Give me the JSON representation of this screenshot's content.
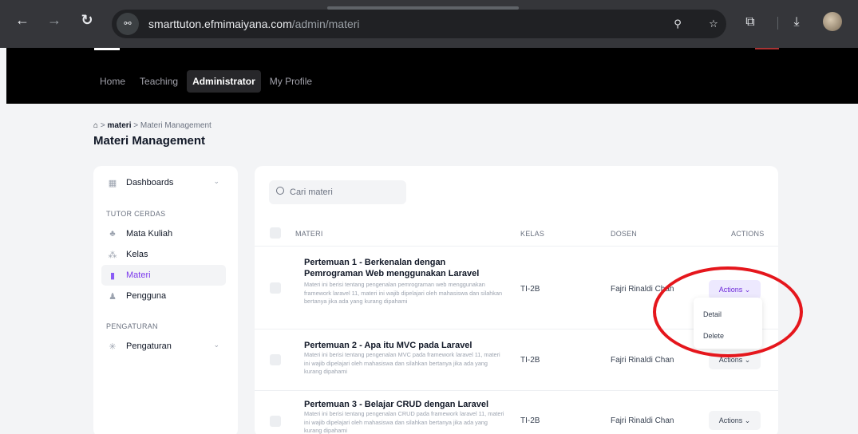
{
  "browser": {
    "url_domain": "smarttuton.efmimaiyana.com",
    "url_path": "/admin/materi",
    "icons": [
      "back-icon",
      "forward-icon",
      "reload-icon",
      "site-info-icon",
      "zoom-icon",
      "bookmark-star-icon",
      "extensions-icon",
      "download-icon",
      "profile-avatar"
    ]
  },
  "header": {
    "nav": [
      "Home",
      "Teaching",
      "Administrator",
      "My Profile"
    ],
    "active_nav": "Administrator"
  },
  "page": {
    "breadcrumb_current": "materi",
    "breadcrumb_sep": ">",
    "breadcrumb_leaf": "Materi Management",
    "title": "Materi Management"
  },
  "sidebar": {
    "dashboards": "Dashboards",
    "section_tutor": "TUTOR CERDAS",
    "items": [
      "Mata Kuliah",
      "Kelas",
      "Materi",
      "Pengguna"
    ],
    "active": "Materi",
    "section_settings": "PENGATURAN",
    "settings": "Pengaturan"
  },
  "table": {
    "search_placeholder": "Cari materi",
    "columns": {
      "materi": "MATERI",
      "kelas": "KELAS",
      "dosen": "DOSEN",
      "actions": "ACTIONS"
    },
    "rows": [
      {
        "title": "Pertemuan 1 - Berkenalan dengan Pemrograman Web menggunakan Laravel",
        "desc": "Materi ini berisi tentang pengenalan pemrograman web menggunakan framework laravel 11, materi ini wajib dipelajari oleh mahasiswa dan silahkan bertanya jika ada yang kurang dipahami",
        "kelas": "TI-2B",
        "dosen": "Fajri Rinaldi Chan",
        "actions": "Actions ⌄"
      },
      {
        "title": "Pertemuan 2 - Apa itu MVC pada Laravel",
        "desc": "Materi ini berisi tentang pengenalan MVC pada framework laravel 11, materi ini wajib dipelajari oleh mahasiswa dan silahkan bertanya jika ada yang kurang dipahami",
        "kelas": "TI-2B",
        "dosen": "Fajri Rinaldi Chan",
        "actions": "Actions ⌄"
      },
      {
        "title": "Pertemuan 3 - Belajar CRUD dengan Laravel",
        "desc": "Materi ini berisi tentang pengenalan CRUD pada framework laravel 11, materi ini wajib dipelajari oleh mahasiswa dan silahkan bertanya jika ada yang kurang dipahami",
        "kelas": "TI-2B",
        "dosen": "Fajri Rinaldi Chan",
        "actions": "Actions ⌄"
      }
    ],
    "dropdown": [
      "Detail",
      "Delete"
    ]
  },
  "colors": {
    "accent": "#7c3aed",
    "annotation": "#e5161c"
  }
}
